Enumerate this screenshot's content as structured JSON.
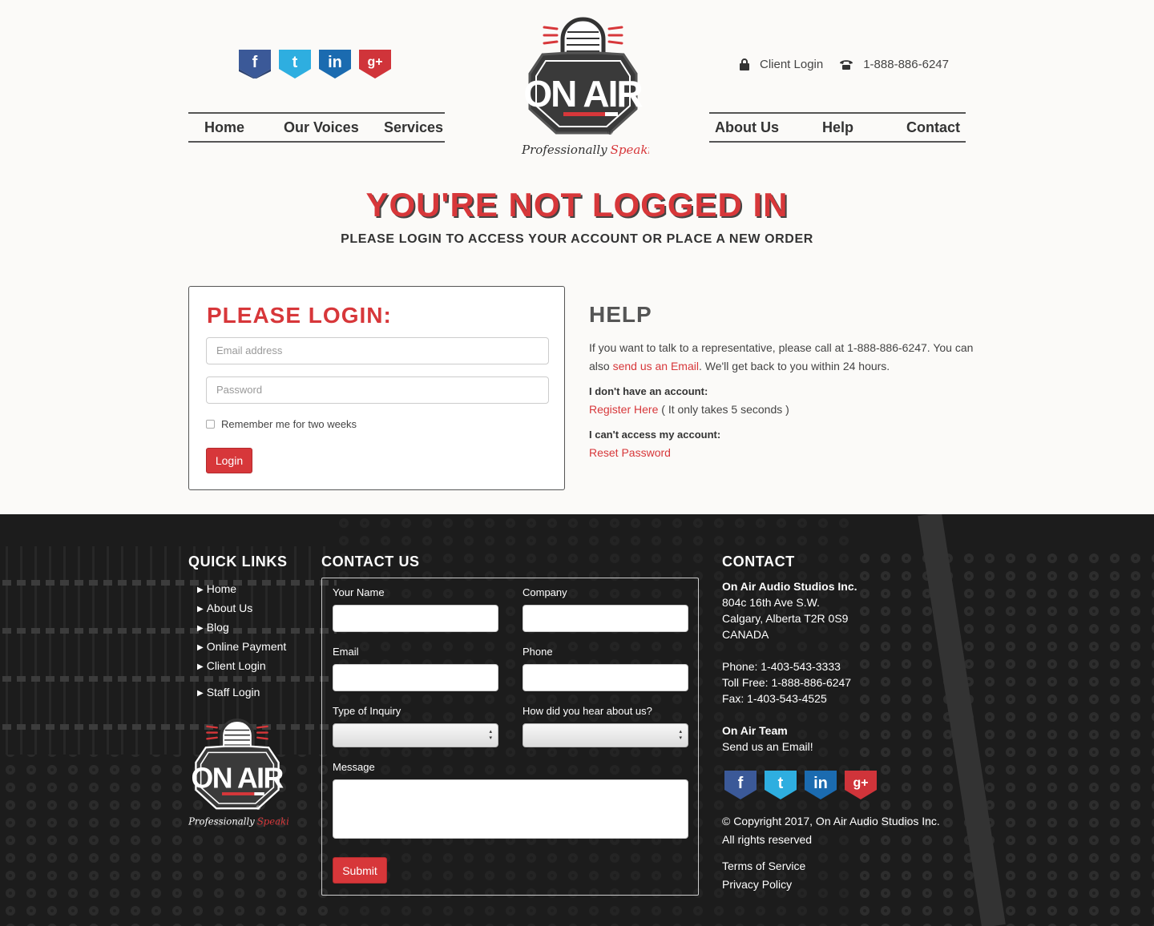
{
  "social": [
    {
      "name": "facebook",
      "glyph": "f",
      "color": "#3b5998"
    },
    {
      "name": "twitter",
      "glyph": "t",
      "color": "#2eaee0"
    },
    {
      "name": "linkedin",
      "glyph": "in",
      "color": "#1b6bb0"
    },
    {
      "name": "google-plus",
      "glyph": "g+",
      "color": "#d0343a"
    }
  ],
  "nav_left": [
    "Home",
    "Our Voices",
    "Services"
  ],
  "nav_right": [
    "About Us",
    "Help",
    "Contact"
  ],
  "top_right": {
    "login": "Client Login",
    "phone": "1-888-886-6247",
    "lock_icon": "lock-icon",
    "phone_icon": "phone-icon"
  },
  "logo": {
    "text": "ON AIR",
    "tagline_1": "Professionally",
    "tagline_2": "Speaking",
    "registered": "®"
  },
  "page": {
    "title": "YOU'RE NOT LOGGED IN",
    "subtitle": "PLEASE LOGIN TO ACCESS YOUR ACCOUNT OR PLACE A NEW ORDER"
  },
  "login": {
    "heading": "PLEASE LOGIN:",
    "email_placeholder": "Email address",
    "password_placeholder": "Password",
    "remember": "Remember me for two weeks",
    "button": "Login"
  },
  "help": {
    "heading": "HELP",
    "p1_a": "If you want to talk to a representative, please call at 1-888-886-6247. You can also ",
    "p1_link": "send us an Email",
    "p1_b": ". We'll get back to you within 24 hours.",
    "no_account_label": "I don't have an account:",
    "register_link": "Register Here",
    "register_note": " ( It only takes 5 seconds )",
    "no_access_label": "I can't access my account:",
    "reset_link": "Reset Password"
  },
  "footer": {
    "quick_links_title": "QUICK LINKS",
    "quick_links": [
      "Home",
      "About Us",
      "Blog",
      "Online Payment",
      "Client Login"
    ],
    "staff_login": "Staff Login",
    "contact_us_title": "CONTACT US",
    "form": {
      "your_name": "Your Name",
      "company": "Company",
      "email": "Email",
      "phone": "Phone",
      "inquiry": "Type of Inquiry",
      "hear": "How did you hear about us?",
      "message": "Message",
      "submit": "Submit"
    },
    "contact_title": "CONTACT",
    "company": "On Air Audio Studios Inc.",
    "address_1": "804c 16th Ave S.W.",
    "address_2": "Calgary, Alberta T2R 0S9",
    "address_3": "CANADA",
    "phone": "Phone: 1-403-543-3333",
    "toll_free": "Toll Free: 1-888-886-6247",
    "fax": "Fax: 1-403-543-4525",
    "team": "On Air Team",
    "team_email": "Send us an Email!",
    "copyright": "© Copyright 2017, On Air Audio Studios Inc.",
    "rights": "All rights reserved",
    "terms": "Terms of Service",
    "privacy": "Privacy Policy"
  }
}
